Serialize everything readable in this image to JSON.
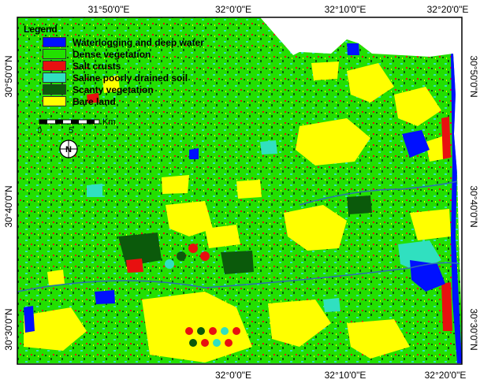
{
  "legend": {
    "title": "Legend",
    "items": [
      {
        "label": "Waterlogging and deep water",
        "color": "#0010ff"
      },
      {
        "label": "Dense vegetation",
        "color": "#22e000"
      },
      {
        "label": "Salt crusts",
        "color": "#e81010"
      },
      {
        "label": "Saline poorly drained soil",
        "color": "#30e0c0"
      },
      {
        "label": "Scanty vegetation",
        "color": "#0b5a0b"
      },
      {
        "label": "Bare land",
        "color": "#ffff00"
      }
    ]
  },
  "scale": {
    "zero": "0",
    "mid": "5",
    "unit": "Km"
  },
  "north": {
    "letter": "N"
  },
  "coordinates": {
    "top": [
      "31°50'0\"E",
      "32°0'0\"E",
      "32°10'0\"E",
      "32°20'0\"E"
    ],
    "bottom": [
      "32°0'0\"E",
      "32°10'0\"E",
      "32°20'0\"E"
    ],
    "left": [
      "30°50'0\"N",
      "30°40'0\"N",
      "30°30'0\"N"
    ],
    "right": [
      "30°50'0\"N",
      "30°40'0\"N",
      "30°30'0\"N"
    ]
  },
  "colors": {
    "background": "#22e000",
    "water": "#0010ff",
    "salt": "#e81010",
    "saline": "#30e0c0",
    "scanty": "#0b5a0b",
    "bare": "#ffff00",
    "frame": "#000000"
  }
}
